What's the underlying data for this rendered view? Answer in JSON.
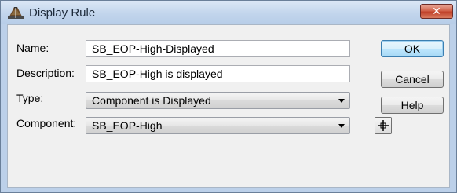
{
  "window": {
    "title": "Display Rule",
    "close_label": "✕"
  },
  "form": {
    "name_label": "Name:",
    "name_value": "SB_EOP-High-Displayed",
    "description_label": "Description:",
    "description_value": "SB_EOP-High is displayed",
    "type_label": "Type:",
    "type_value": "Component is Displayed",
    "component_label": "Component:",
    "component_value": "SB_EOP-High"
  },
  "buttons": {
    "ok": "OK",
    "cancel": "Cancel",
    "help": "Help"
  },
  "icons": {
    "title_icon": "road-template-icon",
    "pick_button_icon": "crosshair-icon"
  }
}
